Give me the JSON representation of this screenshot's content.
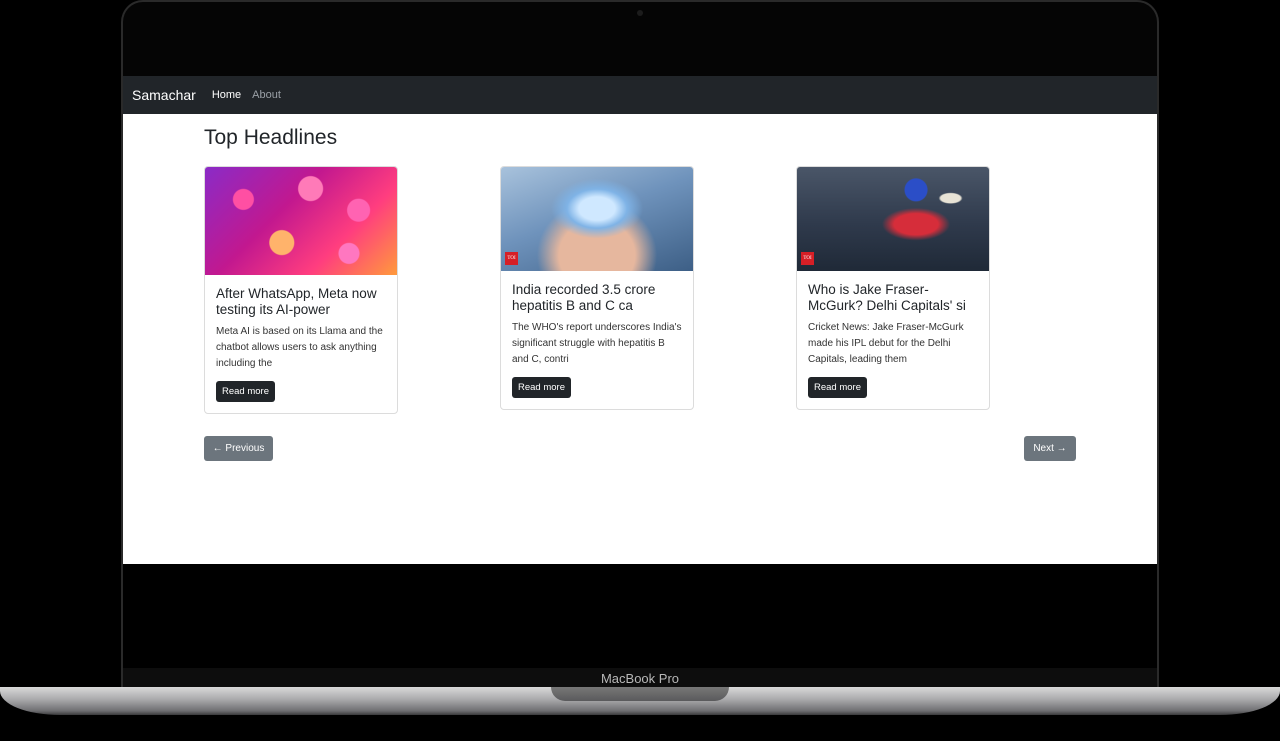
{
  "device": {
    "label": "MacBook Pro"
  },
  "navbar": {
    "brand": "Samachar",
    "links": [
      {
        "label": "Home",
        "active": true
      },
      {
        "label": "About",
        "active": false
      }
    ]
  },
  "page": {
    "title": "Top Headlines"
  },
  "articles": [
    {
      "title": "After WhatsApp, Meta now testing its AI-power",
      "description": "Meta AI is based on its Llama and the chatbot allows users to ask anything including the",
      "button": "Read more",
      "image": "instagram-logos-image"
    },
    {
      "title": "India recorded 3.5 crore hepatitis B and C ca",
      "description": "The WHO's report underscores India's significant struggle with hepatitis B and C, contri",
      "button": "Read more",
      "image": "liver-hands-image",
      "badge": "TOI"
    },
    {
      "title": "Who is Jake Fraser-McGurk? Delhi Capitals' si",
      "description": "Cricket News: Jake Fraser-McGurk made his IPL debut for the Delhi Capitals, leading them",
      "button": "Read more",
      "image": "cricketer-batting-image",
      "badge": "TOI"
    }
  ],
  "pagination": {
    "previous": "← Previous",
    "next": "Next →"
  },
  "colors": {
    "navbar": "#212529",
    "button_dark": "#212529",
    "button_secondary": "#6c757d"
  }
}
